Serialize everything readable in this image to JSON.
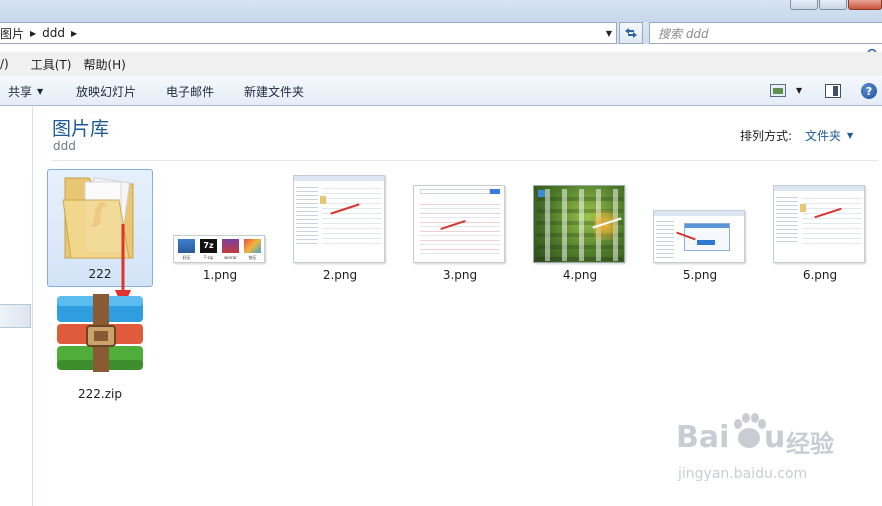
{
  "address": {
    "crumbs": [
      "图片",
      "ddd"
    ],
    "search_placeholder": "搜索 ddd"
  },
  "menu": [
    "/)",
    "工具(T)",
    "帮助(H)"
  ],
  "toolbar": {
    "share": "共享",
    "slideshow": "放映幻灯片",
    "email": "电子邮件",
    "new_folder": "新建文件夹"
  },
  "library": {
    "title": "图片库",
    "subtitle": "ddd",
    "arrange_label": "排列方式:",
    "arrange_value": "文件夹"
  },
  "items": [
    {
      "name": "222",
      "type": "folder",
      "selected": true
    },
    {
      "name": "1.png",
      "type": "image"
    },
    {
      "name": "2.png",
      "type": "image"
    },
    {
      "name": "3.png",
      "type": "image"
    },
    {
      "name": "4.png",
      "type": "image"
    },
    {
      "name": "5.png",
      "type": "image"
    },
    {
      "name": "6.png",
      "type": "image"
    },
    {
      "name": "222.zip",
      "type": "archive"
    }
  ],
  "thumb1_labels": [
    "好压",
    "7-zip",
    "winrar",
    "快压"
  ],
  "watermark": {
    "brand_latin_left": "Bai",
    "brand_latin_right": "u",
    "brand_cn": "经验",
    "url": "jingyan.baidu.com"
  },
  "colors": {
    "accent": "#1e5a96",
    "selection": "#d3e4f7",
    "arrow_red": "#e0322e"
  }
}
